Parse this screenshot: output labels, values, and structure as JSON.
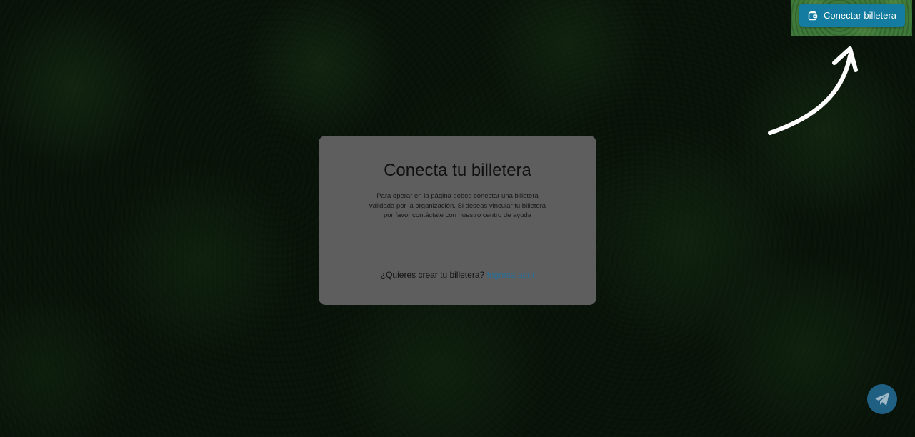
{
  "header": {
    "connect_button_label": "Conectar billetera",
    "connect_button_icon": "wallet-icon"
  },
  "modal": {
    "title": "Conecta tu billetera",
    "description": "Para operar en la página debes conectar una billetera validada por la organización. Si deseas vincular tu billetera por favor contáctate con nuestro centro de ayuda",
    "footer_question": "¿Quieres crear tu billetera?",
    "footer_link": "Ingresa aquí"
  },
  "floating": {
    "telegram_icon": "telegram-icon"
  },
  "colors": {
    "accent": "#137ca0",
    "link": "#2c6f95",
    "modal_bg": "#5e5e5e",
    "telegram_bg": "#1f5f82"
  }
}
